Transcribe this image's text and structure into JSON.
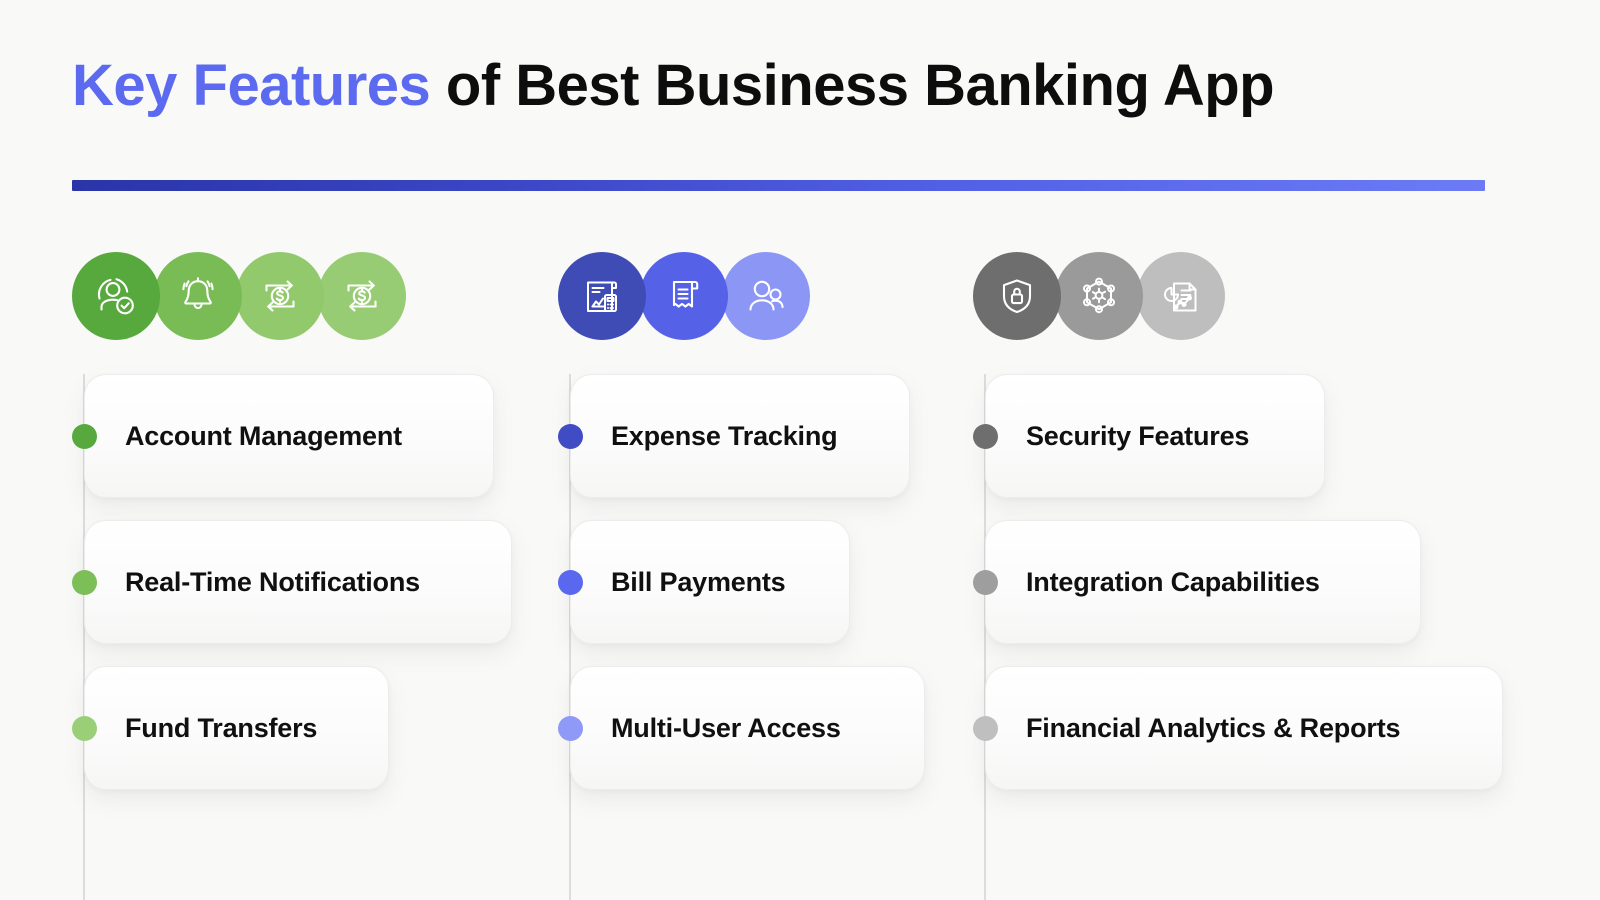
{
  "header": {
    "title_accent": "Key Features",
    "title_rest": " of Best Business Banking App",
    "divider_from": "#2A35A8",
    "divider_to": "#6C7BF5"
  },
  "columns": [
    {
      "name": "accounts",
      "icons": [
        {
          "name": "user-verified-icon",
          "color": "#57A93E"
        },
        {
          "name": "bell-notification-icon",
          "color": "#79BC55"
        },
        {
          "name": "money-transfer-icon",
          "color": "#92C96D"
        },
        {
          "name": "money-transfer-icon",
          "color": "#98CC74"
        }
      ],
      "items": [
        {
          "label": "Account Management",
          "dot_color": "#57A93E"
        },
        {
          "label": "Real-Time Notifications",
          "dot_color": "#7CBE58"
        },
        {
          "label": "Fund Transfers",
          "dot_color": "#9ACF77"
        }
      ]
    },
    {
      "name": "payments",
      "icons": [
        {
          "name": "expense-report-calculator-icon",
          "color": "#3F4CB5"
        },
        {
          "name": "invoice-receipt-icon",
          "color": "#5561E6"
        },
        {
          "name": "multi-user-icon",
          "color": "#8C97F5"
        }
      ],
      "items": [
        {
          "label": "Expense Tracking",
          "dot_color": "#3F4CC4"
        },
        {
          "label": "Bill Payments",
          "dot_color": "#5A68F0"
        },
        {
          "label": "Multi-User Access",
          "dot_color": "#8F99F7"
        }
      ]
    },
    {
      "name": "security",
      "icons": [
        {
          "name": "shield-lock-icon",
          "color": "#6E6E6E"
        },
        {
          "name": "integration-network-gear-icon",
          "color": "#9A9A9A"
        },
        {
          "name": "analytics-report-icon",
          "color": "#BEBEBE"
        }
      ],
      "items": [
        {
          "label": "Security Features",
          "dot_color": "#6E6E6E"
        },
        {
          "label": "Integration Capabilities",
          "dot_color": "#9E9E9E"
        },
        {
          "label": "Financial Analytics & Reports",
          "dot_color": "#BFBFBF"
        }
      ]
    }
  ]
}
